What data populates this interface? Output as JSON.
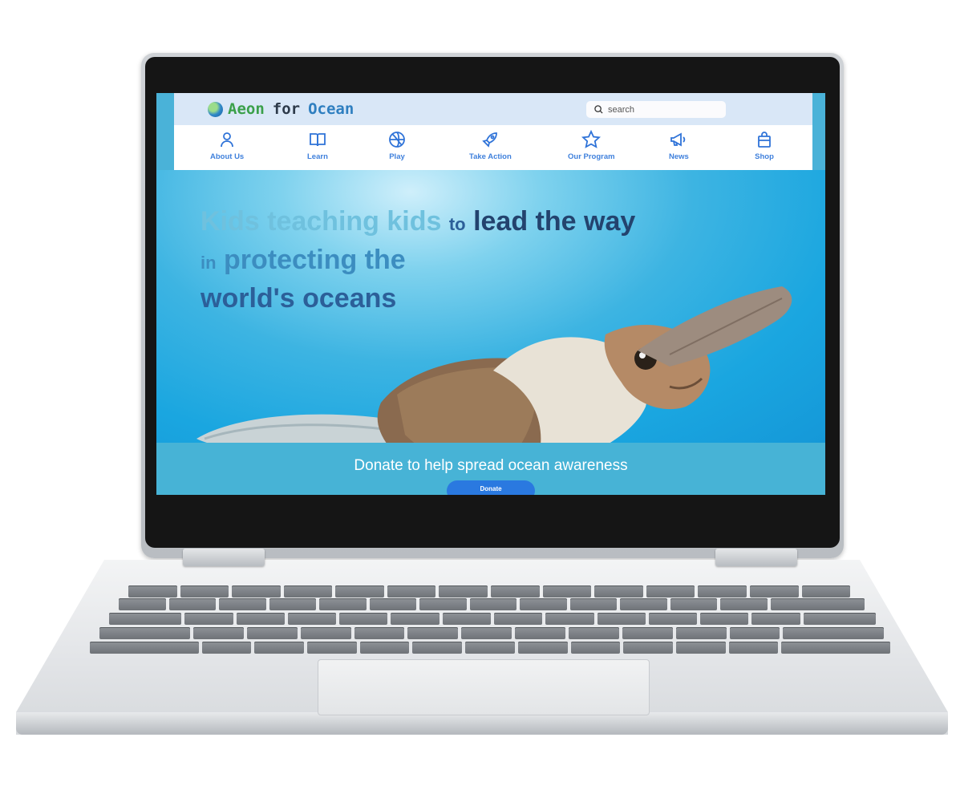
{
  "header": {
    "logo_aeon": "Aeon",
    "logo_for": "for",
    "logo_ocean": "Ocean",
    "search_placeholder": "search"
  },
  "nav": {
    "items": [
      {
        "label": "About Us",
        "icon": "person-icon"
      },
      {
        "label": "Learn",
        "icon": "book-icon"
      },
      {
        "label": "Play",
        "icon": "ball-icon"
      },
      {
        "label": "Take Action",
        "icon": "rocket-icon"
      },
      {
        "label": "Our Program",
        "icon": "star-icon"
      },
      {
        "label": "News",
        "icon": "megaphone-icon"
      },
      {
        "label": "Shop",
        "icon": "bag-icon"
      }
    ]
  },
  "hero": {
    "line1_a": "Kids teaching kids",
    "line1_b": "to",
    "line1_c": "lead the way",
    "line2_a": "in",
    "line2_b": "protecting the",
    "line3": "world's oceans"
  },
  "donate": {
    "text": "Donate to help spread ocean awareness",
    "button": "Donate"
  },
  "colors": {
    "nav_accent": "#2f73d8",
    "donate_button": "#2a79e0",
    "donate_band": "#47b3d6",
    "topbar": "#d9e7f7"
  }
}
